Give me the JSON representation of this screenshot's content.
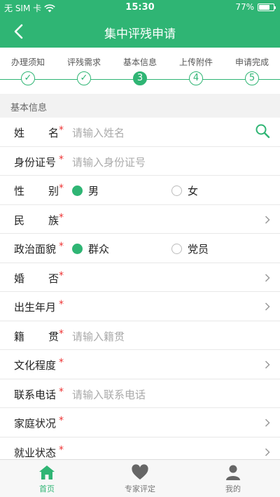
{
  "status": {
    "carrier": "无 SIM 卡",
    "time": "15:30",
    "battery": "77%",
    "battery_level": 0.77
  },
  "nav": {
    "title": "集中评残申请"
  },
  "steps": [
    {
      "label": "办理须知",
      "mark": "✓"
    },
    {
      "label": "评残需求",
      "mark": "✓"
    },
    {
      "label": "基本信息",
      "mark": "3"
    },
    {
      "label": "上传附件",
      "mark": "4"
    },
    {
      "label": "申请完成",
      "mark": "5"
    }
  ],
  "section": {
    "title": "基本信息"
  },
  "form": {
    "name": {
      "label": [
        "姓",
        "名"
      ],
      "star": "*",
      "placeholder": "请输入姓名"
    },
    "idcard": {
      "label": "身份证号",
      "star": "*",
      "placeholder": "请输入身份证号"
    },
    "gender": {
      "label": [
        "性",
        "别"
      ],
      "star": "*",
      "option1": "男",
      "option2": "女"
    },
    "ethnic": {
      "label": [
        "民",
        "族"
      ],
      "star": "*"
    },
    "political": {
      "label": "政治面貌",
      "star": "*",
      "option1": "群众",
      "option2": "党员"
    },
    "marriage": {
      "label": [
        "婚",
        "否"
      ],
      "star": "*"
    },
    "birth": {
      "label": "出生年月",
      "star": "*"
    },
    "native": {
      "label": [
        "籍",
        "贯"
      ],
      "star": "*",
      "placeholder": "请输入籍贯"
    },
    "education": {
      "label": "文化程度",
      "star": "*"
    },
    "phone": {
      "label": "联系电话",
      "star": "*",
      "placeholder": "请输入联系电话"
    },
    "family": {
      "label": "家庭状况",
      "star": "*"
    },
    "employment": {
      "label": "就业状态",
      "star": "*"
    }
  },
  "tabs": [
    {
      "label": "首页",
      "icon": "home-icon"
    },
    {
      "label": "专家评定",
      "icon": "heart-icon"
    },
    {
      "label": "我的",
      "icon": "user-icon"
    }
  ],
  "colors": {
    "accent": "#2fb574",
    "required": "#ee3333"
  }
}
